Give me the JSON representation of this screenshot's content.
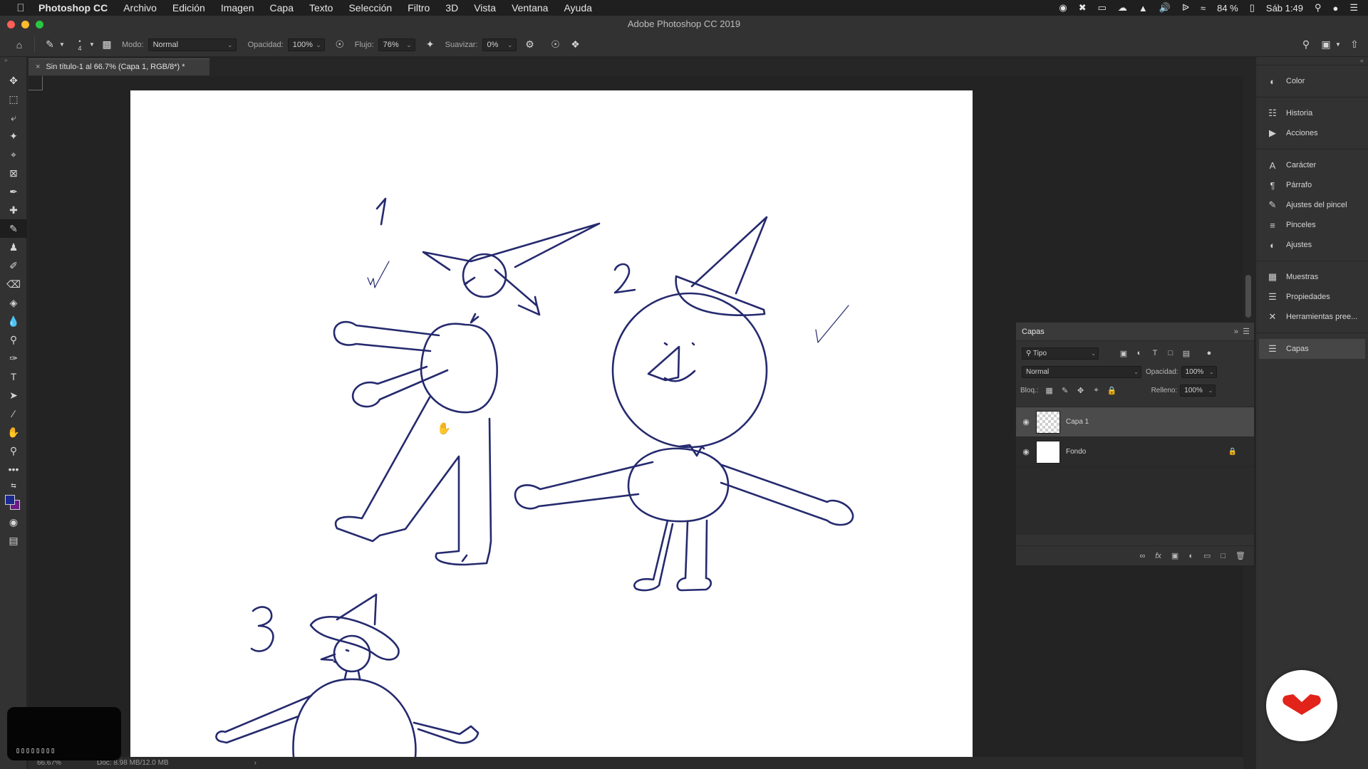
{
  "menubar": {
    "apple_icon": "apple-icon",
    "items": [
      "Photoshop CC",
      "Archivo",
      "Edición",
      "Imagen",
      "Capa",
      "Texto",
      "Selección",
      "Filtro",
      "3D",
      "Vista",
      "Ventana",
      "Ayuda"
    ],
    "battery": "84 %",
    "clock": "Sáb 1:49"
  },
  "window": {
    "title": "Adobe Photoshop CC 2019",
    "colors": {
      "close": "#ff5f57",
      "minimize": "#febc2e",
      "maximize": "#28c840"
    }
  },
  "options": {
    "brush_size": "4",
    "mode_label": "Modo:",
    "mode_value": "Normal",
    "opacity_label": "Opacidad:",
    "opacity_value": "100%",
    "flow_label": "Flujo:",
    "flow_value": "76%",
    "smooth_label": "Suavizar:",
    "smooth_value": "0%"
  },
  "document": {
    "tab_title": "Sin título-1 al 66.7% (Capa 1, RGB/8*) *",
    "zoom": "66.67%",
    "doc_size": "Doc: 8.98 MB/12.0 MB",
    "ink_color": "#252a6e"
  },
  "sketch": {
    "labels": [
      "1",
      "2",
      "3"
    ]
  },
  "toolbar": {
    "foreground_color": "#1c2a8f",
    "background_color": "#6d1b86"
  },
  "panels": {
    "items": [
      {
        "label": "Color",
        "icon": "color-wheel-icon"
      },
      {
        "label": "Historia",
        "icon": "history-icon"
      },
      {
        "label": "Acciones",
        "icon": "play-icon"
      },
      {
        "label": "Carácter",
        "icon": "character-icon"
      },
      {
        "label": "Párrafo",
        "icon": "paragraph-icon"
      },
      {
        "label": "Ajustes del pincel",
        "icon": "brush-settings-icon"
      },
      {
        "label": "Pinceles",
        "icon": "brushes-icon"
      },
      {
        "label": "Ajustes",
        "icon": "adjustments-icon"
      },
      {
        "label": "Muestras",
        "icon": "swatches-icon"
      },
      {
        "label": "Propiedades",
        "icon": "properties-icon"
      },
      {
        "label": "Herramientas pree...",
        "icon": "tool-presets-icon"
      },
      {
        "label": "Capas",
        "icon": "layers-icon"
      }
    ]
  },
  "layers": {
    "title": "Capas",
    "filter_value": "Tipo",
    "blend_value": "Normal",
    "opacity_label": "Opacidad:",
    "opacity_value": "100%",
    "lock_label": "Bloq.:",
    "fill_label": "Relleno:",
    "fill_value": "100%",
    "list": [
      {
        "name": "Capa 1",
        "selected": true,
        "locked": false
      },
      {
        "name": "Fondo",
        "selected": false,
        "locked": true
      }
    ]
  },
  "overlay": {
    "keys": "▯▯▯▯▯▯▯▯"
  }
}
